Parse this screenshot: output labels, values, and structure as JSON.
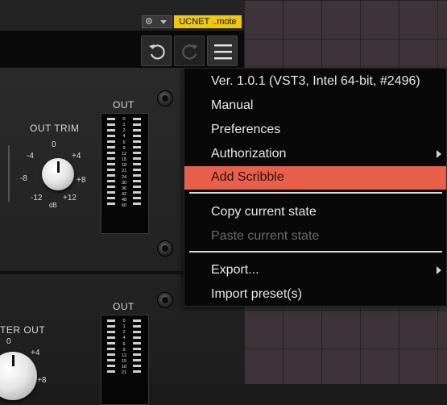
{
  "toolbar": {
    "remote_label": "UCNET ..mote"
  },
  "plugin": {
    "upper": {
      "out_label": "OUT",
      "trim_label": "OUT TRIM",
      "trim_ticks": {
        "t0": "0",
        "m4": "-4",
        "p4": "+4",
        "m8": "-8",
        "p8": "+8",
        "m12": "-12",
        "p12": "+12",
        "db": "dB"
      },
      "meter_scale": [
        "0",
        "1",
        "2",
        "4",
        "6",
        "9",
        "12",
        "15",
        "18",
        "21",
        "24",
        "30",
        "36",
        "42",
        "48",
        "60"
      ]
    },
    "lower": {
      "out_label": "OUT",
      "trim_label": "TER OUT",
      "trim_ticks": {
        "t0": "0",
        "p4": "+4",
        "p8": "+8"
      },
      "meter_scale": [
        "0",
        "1",
        "2",
        "4",
        "6",
        "9",
        "12",
        "15",
        "18",
        "21"
      ]
    }
  },
  "menu": {
    "items": [
      {
        "label": "Ver. 1.0.1 (VST3, Intel 64-bit, #2496)",
        "enabled": true
      },
      {
        "label": "Manual",
        "enabled": true
      },
      {
        "label": "Preferences",
        "enabled": true
      },
      {
        "label": "Authorization",
        "enabled": true,
        "submenu": true
      },
      {
        "label": "Add Scribble",
        "enabled": true,
        "highlighted": true
      },
      {
        "label": "Copy current state",
        "enabled": true
      },
      {
        "label": "Paste current state",
        "enabled": false
      },
      {
        "label": "Export...",
        "enabled": true,
        "submenu": true
      },
      {
        "label": "Import preset(s)",
        "enabled": true
      }
    ]
  },
  "colors": {
    "highlight": "#e8604c",
    "remote_bg": "#f0c814",
    "grid_bg": "#3c3438"
  },
  "icons": [
    "gear-icon",
    "chevron-down-icon",
    "undo-icon",
    "redo-icon",
    "hamburger-menu-icon"
  ]
}
